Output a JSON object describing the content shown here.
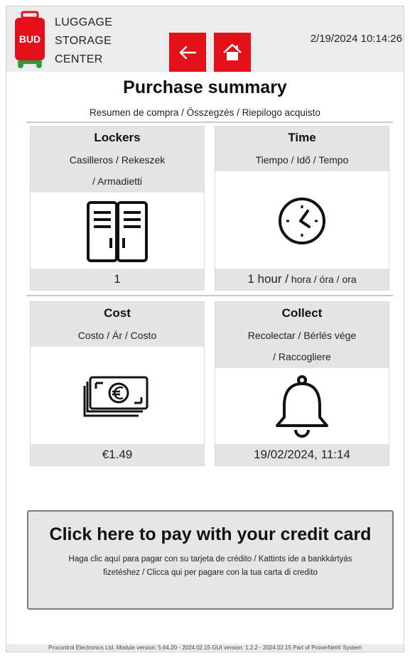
{
  "header": {
    "logo_text": "BUD",
    "brand_lines": [
      "LUGGAGE",
      "STORAGE",
      "CENTER"
    ],
    "datetime": "2/19/2024 10:14:26",
    "back_icon": "arrow-left-icon",
    "home_icon": "home-icon"
  },
  "title": "Purchase summary",
  "subtitle": "Resumen de compra / Összegzés / Riepilogo acquisto",
  "cards": {
    "lockers": {
      "title": "Lockers",
      "sub1": "Casilleros  / Rekeszek",
      "sub2": "/ Armadietti",
      "value": "1",
      "icon": "locker-icon"
    },
    "time": {
      "title": "Time",
      "sub1": "Tiempo  / Idő  / Tempo",
      "value_main": "1 hour /",
      "value_small": " hora  / óra  / ora",
      "icon": "clock-icon"
    },
    "cost": {
      "title": "Cost",
      "sub1": "Costo  / Ár  / Costo",
      "value": "€1.49",
      "icon": "euro-banknotes-icon"
    },
    "collect": {
      "title": "Collect",
      "sub1": "Recolectar  / Bérlés vége",
      "sub2": "/ Raccogliere",
      "value": "19/02/2024, 11:14",
      "icon": "bell-icon"
    }
  },
  "pay": {
    "main": "Click here to pay with your credit card",
    "sub": "Haga clic aquí para pagar con su tarjeta de crédito  / Kattints ide a bankkártyás fizetéshez  / Clicca qui per pagare con la tua carta di credito"
  },
  "footer": "Procontrol Electronics Ltd.  Module version: 5.64.20 - 2024.02.15 GUI version: 1.2.2 - 2024.02.15  Part of ProxerNet® System",
  "colors": {
    "brand_red": "#e3101a",
    "header_bg": "#ececec",
    "card_band": "#e4e4e4",
    "logo_green": "#2a9d3a"
  }
}
